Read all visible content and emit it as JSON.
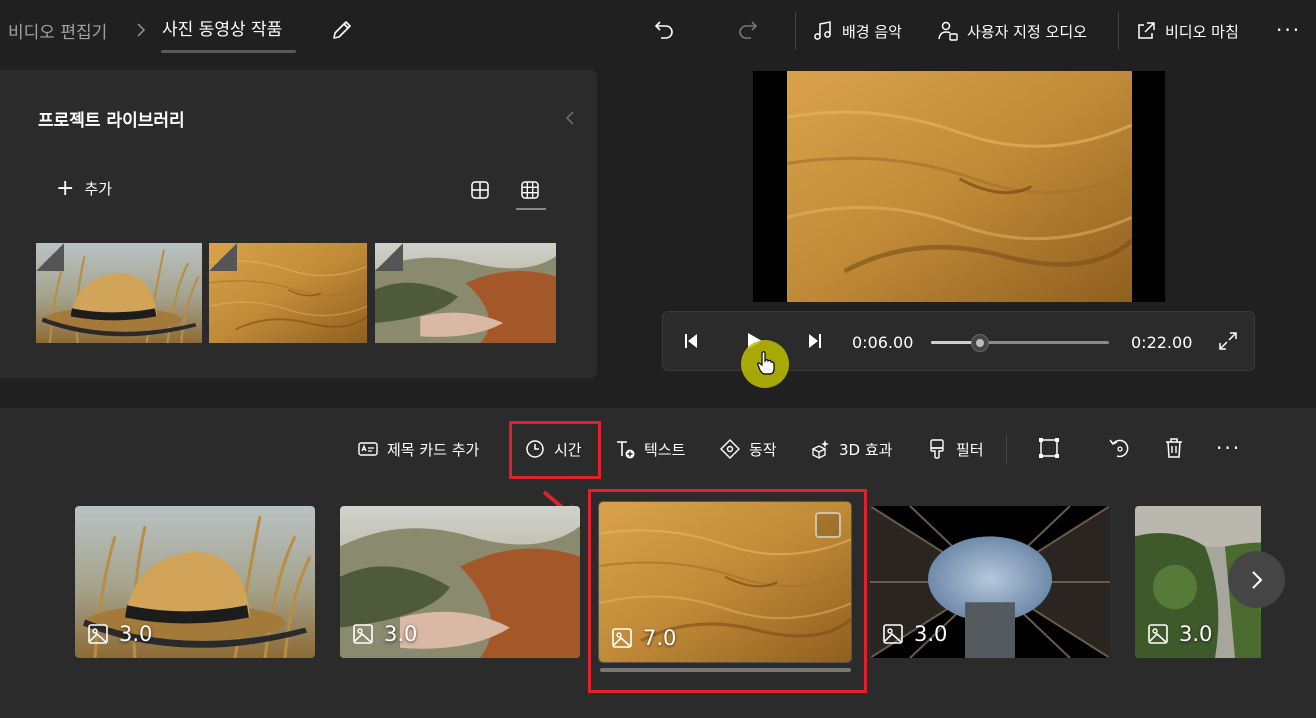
{
  "header": {
    "breadcrumb_root": "비디오 편집기",
    "project_title": "사진 동영상 작품",
    "background_music": "배경 음악",
    "custom_audio": "사용자 지정 오디오",
    "finish_video": "비디오 마침"
  },
  "library": {
    "title": "프로젝트 라이브러리",
    "add_label": "추가",
    "items": [
      "hat-photo",
      "desert-photo",
      "valley-photo"
    ]
  },
  "player": {
    "current_time": "0:06.00",
    "total_time": "0:22.00",
    "progress": 0.2727
  },
  "storyboard": {
    "toolbar": {
      "add_title_card": "제목 카드 추가",
      "duration": "시간",
      "text": "텍스트",
      "motion": "동작",
      "effects_3d": "3D 효과",
      "filters": "필터"
    },
    "clips": [
      {
        "duration": "3.0",
        "image": "hat"
      },
      {
        "duration": "3.0",
        "image": "valley"
      },
      {
        "duration": "7.0",
        "image": "desert",
        "selected": true
      },
      {
        "duration": "3.0",
        "image": "building"
      },
      {
        "duration": "3.0",
        "image": "garden"
      }
    ]
  },
  "colors": {
    "highlight": "#e0202a",
    "background": "#202020",
    "panel": "#2b2b2b"
  }
}
